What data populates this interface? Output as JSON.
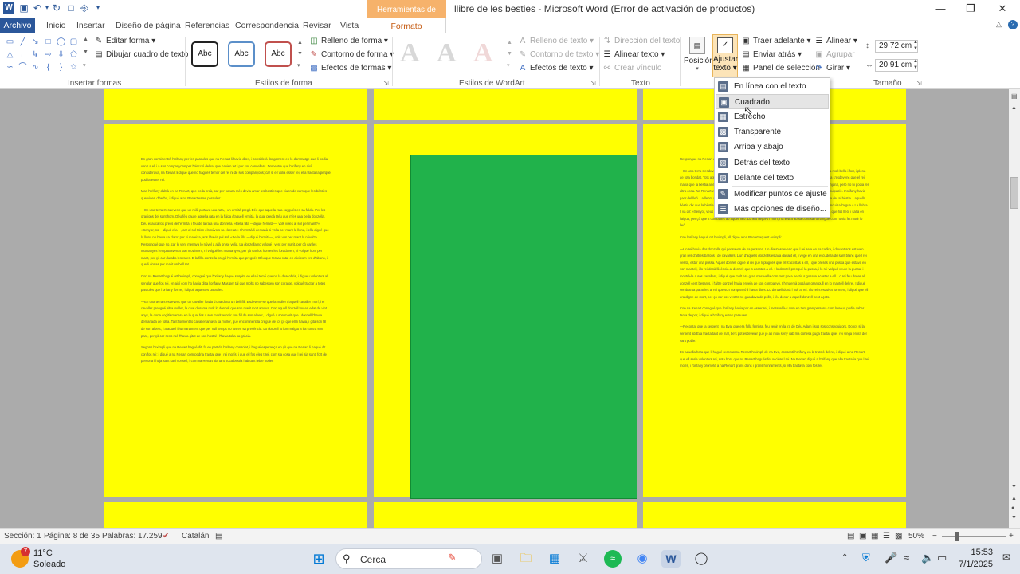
{
  "titlebar": {
    "window_title": "llibre de les besties - Microsoft Word (Error de activación de productos)",
    "context_tab_header": "Herramientas de dibujo",
    "qat_icons": [
      "word-logo-icon",
      "save-icon",
      "undo-icon",
      "redo-icon",
      "new-document-icon",
      "tree-icon",
      "customize-icon"
    ],
    "window_controls": [
      "minimize-icon",
      "restore-icon",
      "close-icon"
    ]
  },
  "tabs": {
    "archivo": "Archivo",
    "items": [
      "Inicio",
      "Insertar",
      "Diseño de página",
      "Referencias",
      "Correspondencia",
      "Revisar",
      "Vista"
    ],
    "formato": "Formato"
  },
  "ribbon": {
    "insertar_formas": {
      "label": "Insertar formas",
      "editar_forma": "Editar forma",
      "dibujar_cuadro": "Dibujar cuadro de texto"
    },
    "estilos_forma": {
      "label": "Estilos de forma",
      "style_samples": [
        "Abc",
        "Abc",
        "Abc"
      ],
      "relleno": "Relleno de forma",
      "contorno": "Contorno de forma",
      "efectos": "Efectos de formas"
    },
    "wordart": {
      "label": "Estilos de WordArt",
      "letters": [
        "A",
        "A",
        "A"
      ],
      "relleno_texto": "Relleno de texto",
      "contorno_texto": "Contorno de texto",
      "efectos_texto": "Efectos de texto"
    },
    "texto": {
      "label": "Texto",
      "direccion": "Dirección del texto",
      "alinear_texto": "Alinear texto",
      "crear_vinculo": "Crear vínculo"
    },
    "organizar": {
      "posicion": "Posición",
      "ajustar_line1": "Ajustar",
      "ajustar_line2": "texto",
      "traer": "Traer adelante",
      "enviar": "Enviar atrás",
      "panel": "Panel de selección",
      "alinear": "Alinear",
      "agrupar": "Agrupar",
      "girar": "Girar"
    },
    "tamano": {
      "label": "Tamaño",
      "height": "29,72 cm",
      "width": "20,91 cm"
    }
  },
  "wrap_menu": {
    "items": [
      {
        "label": "En línea con el texto",
        "icon": "inline-wrap-icon"
      },
      {
        "label": "Cuadrado",
        "icon": "square-wrap-icon"
      },
      {
        "label": "Estrecho",
        "icon": "tight-wrap-icon"
      },
      {
        "label": "Transparente",
        "icon": "through-wrap-icon"
      },
      {
        "label": "Arriba y abajo",
        "icon": "top-bottom-wrap-icon"
      },
      {
        "label": "Detrás del texto",
        "icon": "behind-text-icon"
      },
      {
        "label": "Delante del texto",
        "icon": "in-front-text-icon"
      },
      {
        "label": "Modificar puntos de ajuste",
        "icon": "edit-wrap-points-icon"
      },
      {
        "label": "Más opciones de diseño...",
        "icon": "more-layout-icon"
      }
    ],
    "hovered_index": 1
  },
  "document": {
    "page1_paragraphs": [
      "En gran consir entrà l'orifany per les paraules que na Renart li havia dites, i considerà llongament en lo dammatge que li podia venir a ell i a sos companyons per l'elecció del rei que havien fet i per sos consellers. Domentre que l'orifany en aixì considerava, na Renart li digué que no hagués temor del rei ni de sos companyons; car si ell volia esser rei, ella tractaria perquè podria esser rei.",
      "Mas l'orifany dubtà en na Renart, que no la creà, car per natura més devia amar les besties que viuen de carn que les bèsties que viuen d'herba, i digué a na Renart estes paraules:",
      "—En una terra s'esdevenc que un milà portava una rata, i un ermità pregà Déu que aquella rata caygués en sa falda. Per les oracions del sant hom, Déu féu caure aquella rata en la falda d'aquell ermità, la qual pregà Déu que n'fes una bella donzella. Déu exaucà los precs de l'ermità, i féu de la rata una donzella. «Bella filla —digué l'ermità—, vols voles al sol per marit?» «Senyor, no —digué ella—, car al sol tolen els núvols sa claretat.» I l'ermità li demanà si volia per marit la lluna, i ella digué que la lluna no havia sa claror per si mateixa, ans l'havia pel sol. «Bella filla —digué l'ermità—, vols vos per marit lo núvol?» Responguè que no, car lo vent menava lo núvol a allà on se volia. La donzella no volgué l vent per marit, per çò car les muntanyes l'empatxaven a son moviment, ni volgué les muntanyes, per çò car los homes les foradaven; ni volgué hom per marit, per çò car duraba les rates. E la filla donzella pregà l'ermità que pregués Déu que tornas rata, en aixi com era d'abans, i que li donas per marit un bell rat.",
      "Con na Renart hagué oït l'eximpli, conegué que l'orifany hagué sospita en ella i temé que no la descobris, i digueu volenters al senglar que fos rei, en així com ho havia dit a l'orifany. Mas per tal que molts no sabessen son coratge, volgué tractar a totes paraules que l'orifany fos rei, i digué aquestes paraules:",
      "—En una terra s'esdevenc que un cavaller havia d'una dona un bell fill. Esdevenc-se que la muller d'aquell cavaller morí, i el cavaller prengué altra muller, la qual desama molt lo donzell que son marit molt amava. Con aquell donzell fou en edat de vint anys, la dona cogità manera en la qual fes a son marit avorrir son fill de son alberc, i digué a son marit que l donzell l'havia demanada de follia. Tant forment lo cavaller amava sa muller, que encontinent la cregué de tot çò que ell li havia, i gità son fill de son alberc, i a aquell féu manament que per null temps no fos en sa presència. Lo donzell fo fort malgut a ira contra son pare, per çò car sens raó l'havia gitat de son hostal i l'havia tolta sa gràcia.",
      "Segons l'eximpli que na Renart hagué dit, fo en partida l'orifany consolat, i hagué esperança en çò que na Renart li hagué dit con fos rei; i digué a na Renart com podria tractar que l rei morís, i que ell fos eleg t rei, com sia cosa que l rei sia sant, fort de persona i haja sant savi consell, i com na Renart sia tant poca bestia i ab tant feble poder."
    ],
    "page3_paragraphs": [
      "Respongué na Renart e dix:",
      "—En una terra s'esdevenc que un rei havia un castell en lo qual havia una bestia al lleó, per çò car era molt bella i fort, i plena de tota bondat. Tots aquells bestiars que eren en aquell castell havien paor del lleó i menjava-la. Un dia s'esdevenc que el rei mana que la bèstia anés a la cort, i que estigués a la seua guarda. Ja sabia la bèstia que el lleó la menjaria, però no hi podia fer altra cosa. Na Renart va dir al lleó que mengés la bestia. Lo lleó fo mort nat i cuidà-s que l'orifany fos culpable. L'orifany havia paor del lleó. La llebra se va anar primera, i lo lleó la seguí. Lo lleó respon a la llebra, car gran ira havia de tal bèstia. I aquella bèstia dix que la bèstia anés per l'aigua. «Senyor, no féu mal, que jo sóc ací per vós servir, i us vull conduir a l'aigua.» La llebra li va dir: «Senyor, veus la lleó que és en l'aigua i vol menjar una llebra?» Lo lleó se cuidà fos sa ombra que fos lleó, i saltà en l'aigua, per çò que s combatés ab aquell lleó. Lo lleó negà-s i morí, i la llebra ab sa cortesa romangué com havia fet morir lo lleó.",
      "Con l'orifany hagué oït l'eximpli, ell digué a na Renart aquest eximpli:",
      "—Un rei havia dos donzells qui pensaven de sa persona. Un dia s'esdevenc que l rei sela en sa cadira, i davant sos estaven gran res d'altres barons i de cavallers. L'un d'aquells donzells estava davant ell, i vegé en una escudella de sant blanc que l rei vesita, estar una pussa. Aquell donzell digué al rei que li plagués que ell s'acostas a ell, i que presés una pussa que estava en son mantell, i lo rei donà llicència al donzell que s acostas a ell. I lo donzell prengué la pussa, i lo rei volgué veure la pussa, i mostrà-la a sos cavallers, i digué que molt era gran meravella com tant poca bestia s gosava acostar a ell. Lo rei féu donar al donzell cent besants, i l'altre donzell havia enveja de son companyó. I l'endemà posà un gran pull en lo mantell del rei. I digué semblanta paraules al rei que son companyó li havia dites. Lo donzell donà l poll al rei. I lo rei s'esquiva fortment, i digué que ell era digne de mort, per çò car sos vestits no guardava de polls, i féu donar a aquell donzell cent açots.",
      "Con na Renart conegué que l'orifany havia por en esser rei, i meravellà-s com en tant gran persona com la seua podia caber tanta de por, i digué a l'orifany estes paraules:",
      "—Recontat que la serpent i na Eva, que era folla fembra, féu venir en la ira de Déu Adam i sos sos conseguidors. Doncs si la serpent ab Eva tracta tant de mal, be's pot esdevenir que jo ab mon seny i ab ma cortesa puga tractar que l rei vinga en ira del sant poble.",
      "En aquella hora que li hagué recontat na Renart l'eximpli de na Eva, consentí l'orifany en la traïció del rei, i digué a na Renart que ell seria volenters rei, sota hora que na Renart hagués fet occiure l rei. Na Renart digué a l'orifany que ella tractaria que l rei morís, i l'orifany prometé a na Renart grans dons i grans honraments, si ella tractava com fos rei."
    ]
  },
  "statusbar": {
    "seccion": "Sección: 1",
    "pagina": "Página: 8 de 35",
    "palabras": "Palabras: 17.259",
    "idioma": "Catalán",
    "zoom": "50%"
  },
  "taskbar": {
    "weather_badge": "7",
    "temperature": "11°C",
    "weather_text": "Soleado",
    "search_placeholder": "Cerca",
    "time": "15:53",
    "date": "7/1/2025"
  },
  "colors": {
    "page_yellow": "#ffff00",
    "shape_green": "#21b24b",
    "word_blue": "#2b579a",
    "context_orange": "#f6b26b"
  }
}
